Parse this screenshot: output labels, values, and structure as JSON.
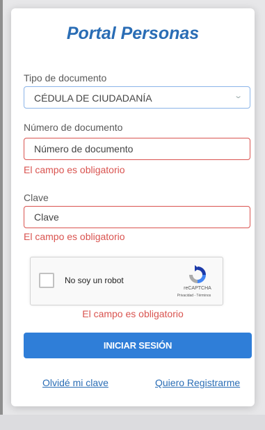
{
  "header": {
    "title": "Portal Personas"
  },
  "document_type": {
    "label": "Tipo de documento",
    "selected_value": "CÉDULA DE CIUDADANÍA"
  },
  "document_number": {
    "label": "Número de documento",
    "placeholder": "Número de documento",
    "value": "",
    "error": "El campo es obligatorio"
  },
  "password": {
    "label": "Clave",
    "placeholder": "Clave",
    "value": "",
    "error": "El campo es obligatorio"
  },
  "captcha": {
    "checkbox_label": "No soy un robot",
    "brand": "reCAPTCHA",
    "terms": "Privacidad - Términos",
    "error": "El campo es obligatorio"
  },
  "actions": {
    "submit_label": "INICIAR SESIÓN",
    "forgot_password_link": "Olvidé mi clave",
    "register_link": "Quiero Registrarme"
  },
  "colors": {
    "brand_blue": "#2a6db5",
    "button_blue": "#2f7ed8",
    "error_red": "#d9534f"
  }
}
